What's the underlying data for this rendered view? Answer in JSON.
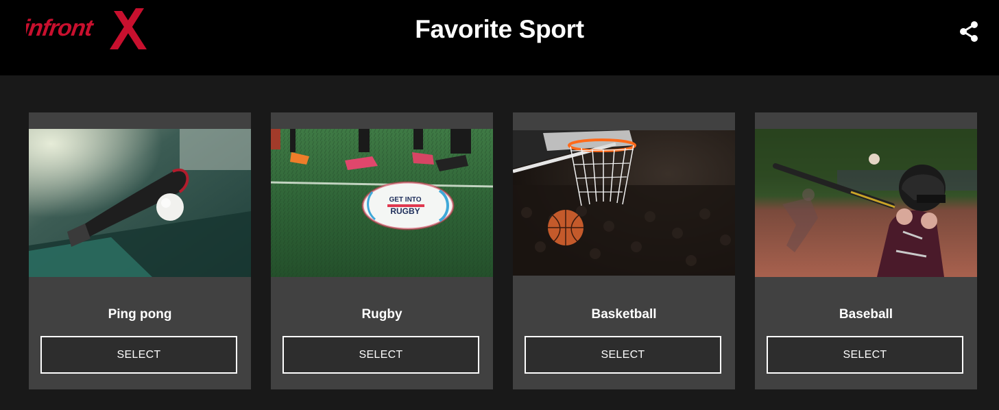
{
  "header": {
    "logo_text": "infrontX",
    "title": "Favorite Sport",
    "share_icon": "share-icon"
  },
  "colors": {
    "brand_red": "#c8102e",
    "header_bg": "#000000",
    "page_bg": "#191919",
    "card_bg": "#414141"
  },
  "cards": [
    {
      "title": "Ping pong",
      "button": "SELECT",
      "image": "ping-pong-paddle-and-ball-photo"
    },
    {
      "title": "Rugby",
      "button": "SELECT",
      "image": "rugby-ball-on-grass-photo",
      "ball_text_1": "GET INTO",
      "ball_text_2": "RUGBY"
    },
    {
      "title": "Basketball",
      "button": "SELECT",
      "image": "basketball-through-hoop-photo"
    },
    {
      "title": "Baseball",
      "button": "SELECT",
      "image": "child-batting-baseball-photo"
    }
  ]
}
